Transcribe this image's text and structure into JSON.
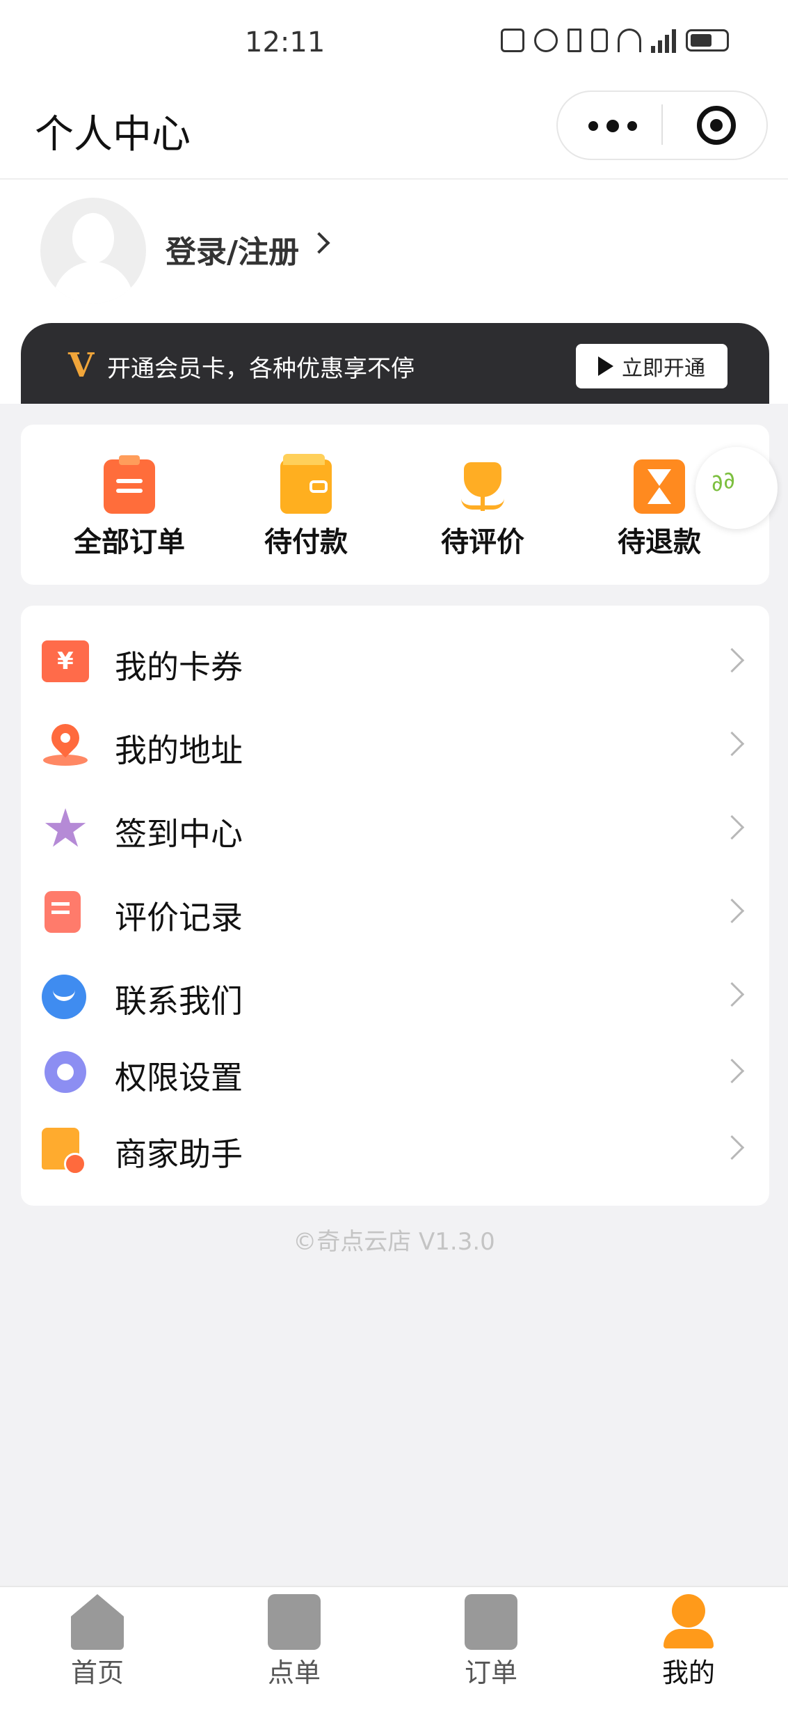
{
  "status_bar": {
    "time": "12:11"
  },
  "header": {
    "title": "个人中心"
  },
  "profile": {
    "login_label": "登录/注册"
  },
  "vip_banner": {
    "badge": "V",
    "text": "开通会员卡，各种优惠享不停",
    "button_label": "立即开通"
  },
  "orders": [
    {
      "label": "全部订单",
      "icon": "clipboard-icon"
    },
    {
      "label": "待付款",
      "icon": "wallet-icon"
    },
    {
      "label": "待评价",
      "icon": "flower-icon"
    },
    {
      "label": "待退款",
      "icon": "hourglass-icon"
    }
  ],
  "menu": [
    {
      "label": "我的卡券",
      "icon": "coupon-icon"
    },
    {
      "label": "我的地址",
      "icon": "location-pin-icon"
    },
    {
      "label": "签到中心",
      "icon": "star-icon"
    },
    {
      "label": "评价记录",
      "icon": "note-icon"
    },
    {
      "label": "联系我们",
      "icon": "chat-icon"
    },
    {
      "label": "权限设置",
      "icon": "gear-icon"
    },
    {
      "label": "商家助手",
      "icon": "shop-icon"
    }
  ],
  "version": "©奇点云店 V1.3.0",
  "tabbar": [
    {
      "label": "首页",
      "icon": "home-icon"
    },
    {
      "label": "点单",
      "icon": "order-bag-icon"
    },
    {
      "label": "订单",
      "icon": "clipboard-icon"
    },
    {
      "label": "我的",
      "icon": "person-icon",
      "active": true
    }
  ],
  "colors": {
    "accent": "#ff9a1a",
    "vip_bg": "#2d2d30",
    "page_bg": "#f2f2f4"
  }
}
